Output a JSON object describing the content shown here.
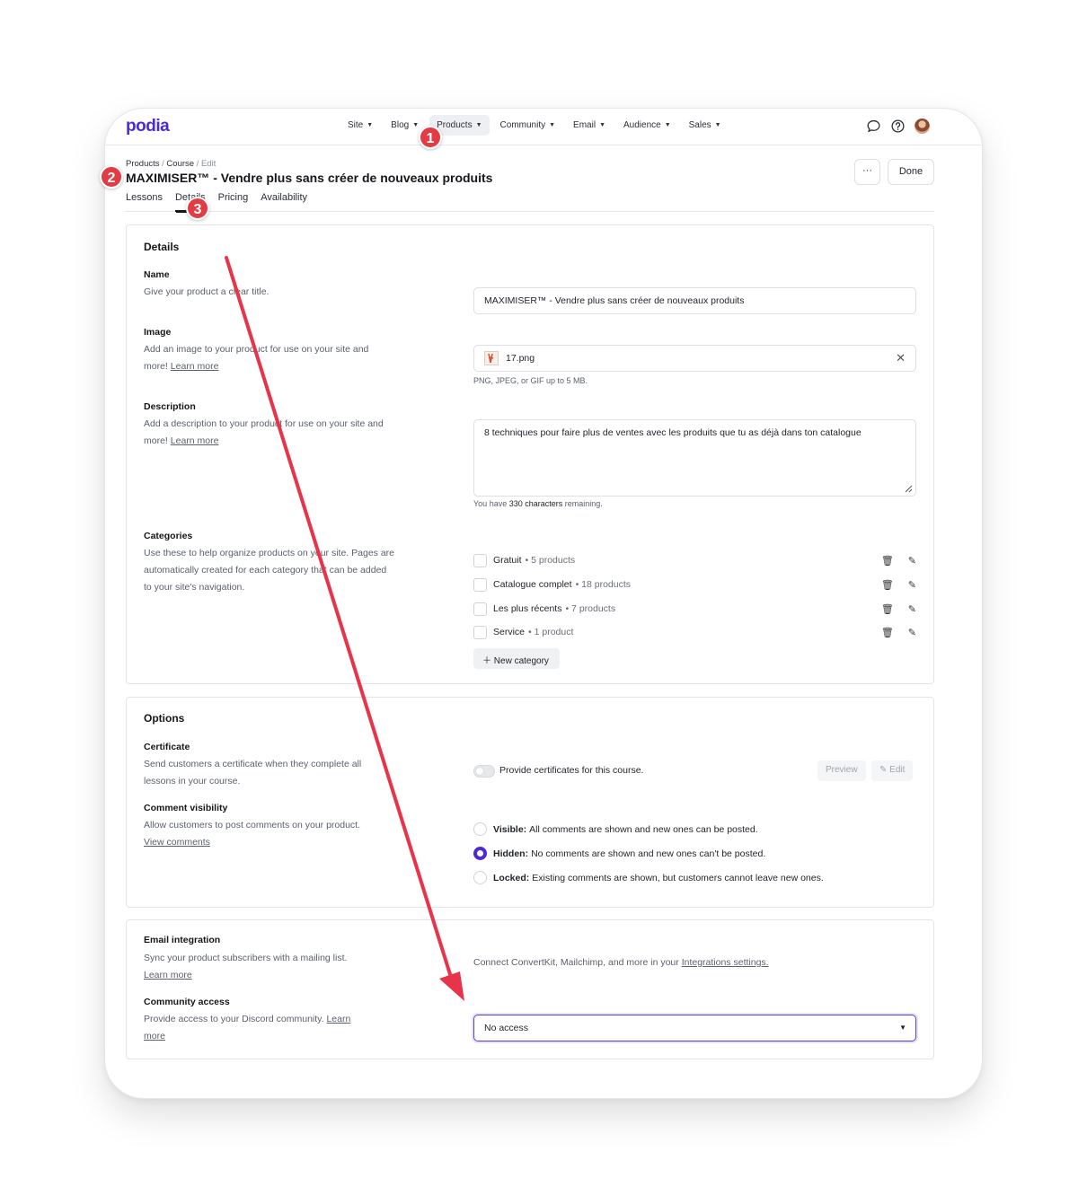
{
  "app": {
    "logo": "podia"
  },
  "nav": [
    {
      "label": "Site",
      "active": false
    },
    {
      "label": "Blog",
      "active": false
    },
    {
      "label": "Products",
      "active": true
    },
    {
      "label": "Community",
      "active": false
    },
    {
      "label": "Email",
      "active": false
    },
    {
      "label": "Audience",
      "active": false
    },
    {
      "label": "Sales",
      "active": false
    }
  ],
  "header_icons": [
    "chat-icon",
    "help-icon",
    "user-avatar"
  ],
  "breadcrumb": {
    "products": "Products",
    "sep1": " / ",
    "course": "Course",
    "sep2": " / ",
    "edit": "Edit"
  },
  "page_title": "MAXIMISER™ - Vendre plus sans créer de nouveaux produits",
  "actions": {
    "more": "···",
    "done": "Done"
  },
  "tabs": [
    {
      "label": "Lessons",
      "active": false
    },
    {
      "label": "Details",
      "active": true
    },
    {
      "label": "Pricing",
      "active": false
    },
    {
      "label": "Availability",
      "active": false
    }
  ],
  "details": {
    "heading": "Details",
    "name": {
      "label": "Name",
      "desc": "Give your product a clear title.",
      "value": "MAXIMISER™ - Vendre plus sans créer de nouveaux produits"
    },
    "image": {
      "label": "Image",
      "desc": "Add an image to your product for use on your site and more!",
      "learn_more": "Learn more",
      "file_name": "17.png",
      "hint": "PNG, JPEG, or GIF up to 5 MB."
    },
    "description": {
      "label": "Description",
      "desc": "Add a description to your product for use on your site and more!",
      "learn_more": "Learn more",
      "value": "8 techniques pour faire plus de ventes avec les produits que tu as déjà dans ton catalogue",
      "hint_pre": "You have ",
      "hint_count": "330 characters",
      "hint_post": " remaining."
    },
    "categories": {
      "label": "Categories",
      "desc": "Use these to help organize products on your site. Pages are automatically created for each category that can be added to your site's navigation.",
      "items": [
        {
          "name": "Gratuit",
          "meta": "• 5 products"
        },
        {
          "name": "Catalogue complet",
          "meta": "• 18 products"
        },
        {
          "name": "Les plus récents",
          "meta": "• 7 products"
        },
        {
          "name": "Service",
          "meta": "• 1 product"
        }
      ],
      "new_button": "New category"
    }
  },
  "options": {
    "heading": "Options",
    "certificate": {
      "label": "Certificate",
      "desc": "Send customers a certificate when they complete all lessons in your course.",
      "toggle_label": "Provide certificates for this course.",
      "toggle_on": false,
      "preview": "Preview",
      "edit": "Edit"
    },
    "comments": {
      "label": "Comment visibility",
      "desc": "Allow customers to post comments on your product.",
      "view_link": "View comments",
      "choices": [
        {
          "title": "Visible:",
          "text": "All comments are shown and new ones can be posted.",
          "selected": false
        },
        {
          "title": "Hidden:",
          "text": "No comments are shown and new ones can't be posted.",
          "selected": true
        },
        {
          "title": "Locked:",
          "text": "Existing comments are shown, but customers cannot leave new ones.",
          "selected": false
        }
      ]
    }
  },
  "integrations": {
    "email": {
      "label": "Email integration",
      "desc": "Sync your product subscribers with a mailing list.",
      "learn_more": "Learn more",
      "text": "Connect ConvertKit, Mailchimp, and more in your ",
      "link": "Integrations settings."
    },
    "community": {
      "label": "Community access",
      "desc": "Provide access to your Discord community.",
      "learn": "Learn",
      "more": "more",
      "selected": "No access"
    }
  },
  "annotations": {
    "badge1": "1",
    "badge2": "2",
    "badge3": "3",
    "arrow_color": "#e8344a",
    "badge_color": "#e23b44"
  },
  "colors": {
    "brand": "#4b2bd3",
    "border": "#e2e4e8",
    "text": "#1f2328",
    "muted": "#5b616b"
  }
}
